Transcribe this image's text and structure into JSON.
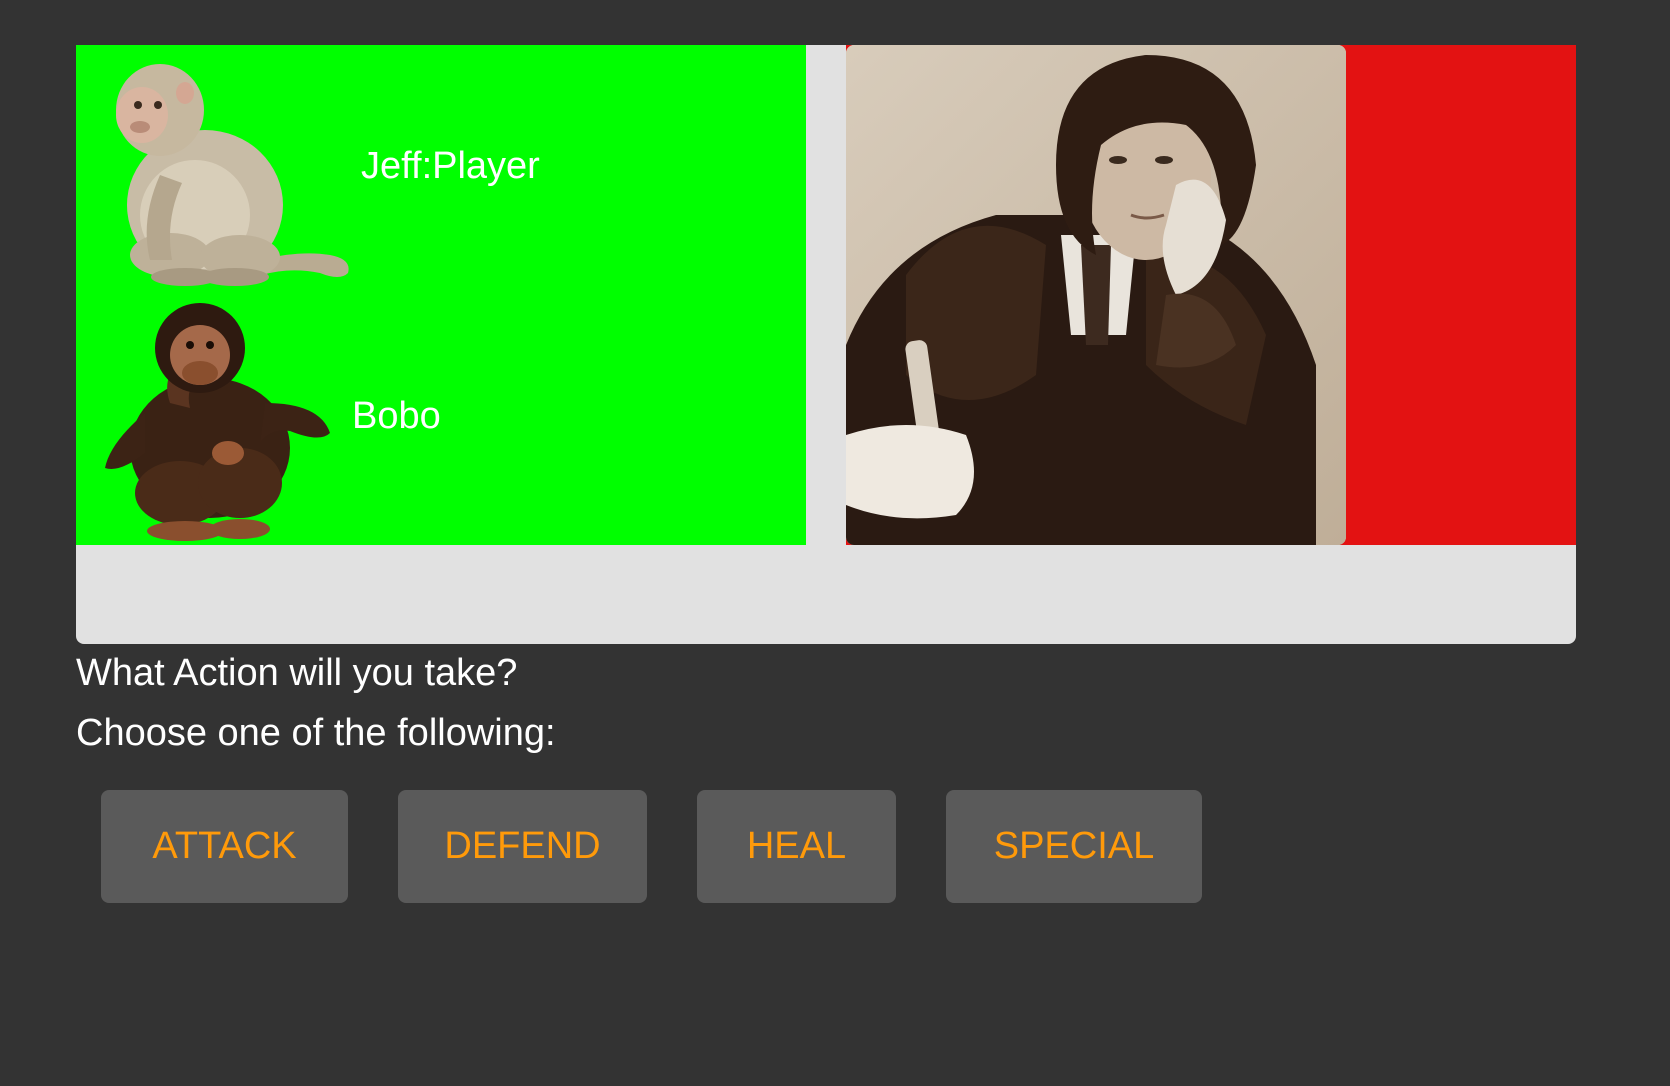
{
  "player_side": {
    "panel_color": "#00ff00",
    "creatures": [
      {
        "name": "Jeff:Player",
        "icon": "macaque-icon"
      },
      {
        "name": "Bobo",
        "icon": "chimpanzee-icon"
      }
    ]
  },
  "enemy_side": {
    "panel_color": "#e31212",
    "portrait_icon": "victorian-man-portrait"
  },
  "prompt": {
    "line1": "What Action will you take?",
    "line2": "Choose one of the following:"
  },
  "actions": [
    {
      "label": "ATTACK"
    },
    {
      "label": "DEFEND"
    },
    {
      "label": "HEAL"
    },
    {
      "label": "SPECIAL"
    }
  ],
  "colors": {
    "background": "#333333",
    "button_bg": "#5a5a5a",
    "button_text": "#ff9a0a",
    "frame": "#e1e1e1"
  }
}
